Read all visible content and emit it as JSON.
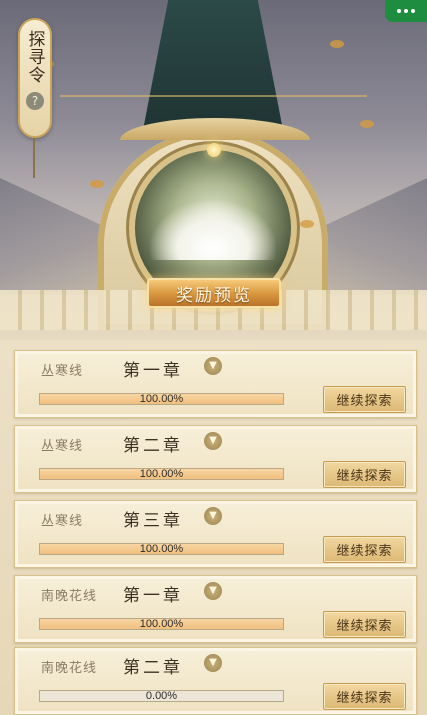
{
  "badge": {
    "title": "探寻令",
    "help_icon": "?"
  },
  "reward_button": "奖励预览",
  "chapters": [
    {
      "line": "丛寒线",
      "chapter": "第一章",
      "progress": 1.0,
      "progress_label": "100.00%",
      "button": "继续探索"
    },
    {
      "line": "丛寒线",
      "chapter": "第二章",
      "progress": 1.0,
      "progress_label": "100.00%",
      "button": "继续探索"
    },
    {
      "line": "丛寒线",
      "chapter": "第三章",
      "progress": 1.0,
      "progress_label": "100.00%",
      "button": "继续探索"
    },
    {
      "line": "南晚花线",
      "chapter": "第一章",
      "progress": 1.0,
      "progress_label": "100.00%",
      "button": "继续探索"
    },
    {
      "line": "南晚花线",
      "chapter": "第二章",
      "progress": 0.0,
      "progress_label": "0.00%",
      "button": "继续探索"
    }
  ],
  "colors": {
    "progress_fill": "#f0bf7e",
    "button_gold": "#dcb874",
    "menu_green": "#1f8d3f"
  }
}
